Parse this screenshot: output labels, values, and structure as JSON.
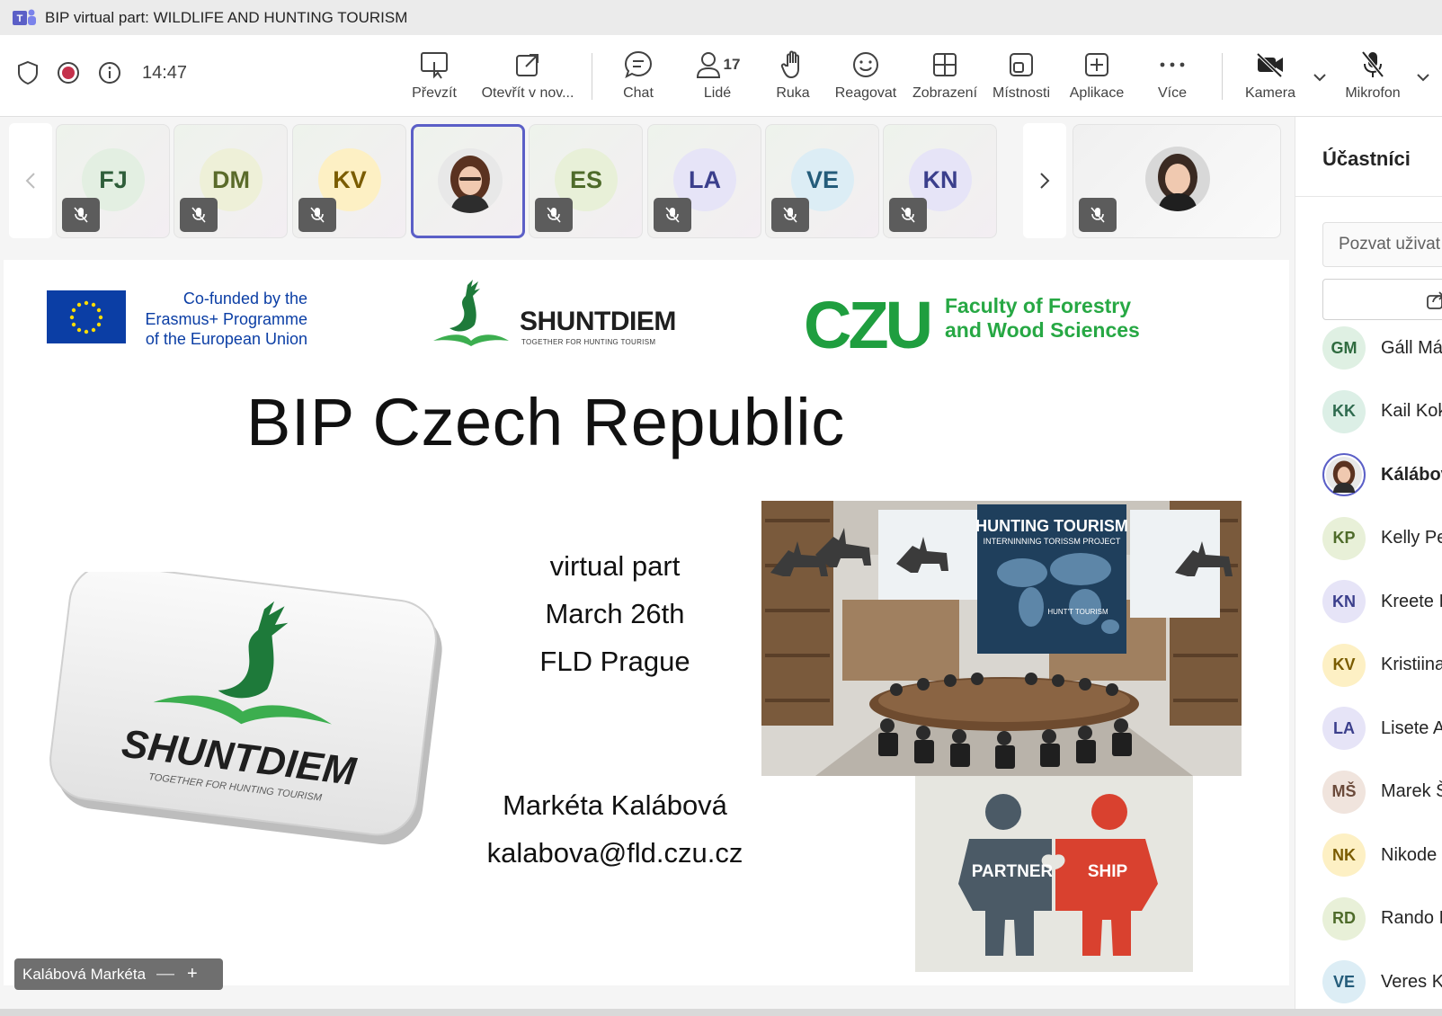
{
  "window": {
    "title": "BIP virtual part: WILDLIFE AND HUNTING TOURISM"
  },
  "toolbar": {
    "time": "14:47",
    "buttons": {
      "take_control": "Převzít",
      "open_new": "Otevřít v nov...",
      "chat": "Chat",
      "people": "Lidé",
      "people_count": "17",
      "hand": "Ruka",
      "react": "Reagovat",
      "view": "Zobrazení",
      "rooms": "Místnosti",
      "apps": "Aplikace",
      "more": "Více",
      "camera": "Kamera",
      "mic": "Mikrofon"
    }
  },
  "participants_strip": [
    {
      "initials": "FJ",
      "color": "#2f5e3a",
      "bg": "#e3efe2"
    },
    {
      "initials": "DM",
      "color": "#5a6b2a",
      "bg": "#eef0d8"
    },
    {
      "initials": "KV",
      "color": "#7a5c00",
      "bg": "#fdf0c4"
    },
    {
      "initials": "",
      "photo": true
    },
    {
      "initials": "ES",
      "color": "#4e6b2a",
      "bg": "#e8f0d8"
    },
    {
      "initials": "LA",
      "color": "#3b3f8c",
      "bg": "#e6e4f7"
    },
    {
      "initials": "VE",
      "color": "#245c7a",
      "bg": "#dcedf5"
    },
    {
      "initials": "KN",
      "color": "#3b3f8c",
      "bg": "#e6e4f7"
    }
  ],
  "slide": {
    "eu_text": [
      "Co-funded by the",
      "Erasmus+ Programme",
      "of the European Union"
    ],
    "shuntdiem_name": "SHUNTDIEM",
    "shuntdiem_tagline": "TOGETHER FOR HUNTING TOURISM",
    "czu_letters": "CZU",
    "faculty": [
      "Faculty of Forestry",
      "and Wood Sciences"
    ],
    "title": "BIP Czech Republic",
    "info": [
      "virtual part",
      "March 26th",
      "FLD Prague"
    ],
    "contact": [
      "Markéta Kalábová",
      "kalabova@fld.czu.cz"
    ],
    "poster_title": "HUNTING TOURISM",
    "poster_subtitle": "INTERNINNING TORISSM PROJECT",
    "poster_small": "HUNT'T TOURISM",
    "partner_left": "PARTNER",
    "partner_right": "SHIP"
  },
  "presenter_tag": {
    "name": "Kalábová Markéta",
    "minus": "—",
    "plus": "+"
  },
  "sidebar": {
    "title": "Účastníci",
    "invite_placeholder": "Pozvat uživat",
    "people": [
      {
        "initials": "GM",
        "name": "Gáll Má",
        "color": "#2f6b3f",
        "bg": "#dff0e3"
      },
      {
        "initials": "KK",
        "name": "Kail Kok",
        "color": "#2f6b4f",
        "bg": "#dcefe6"
      },
      {
        "initials": "",
        "name": "Kálábov",
        "photo": true,
        "me": true
      },
      {
        "initials": "KP",
        "name": "Kelly Pe",
        "color": "#4e6b2a",
        "bg": "#e8f0d8"
      },
      {
        "initials": "KN",
        "name": "Kreete I",
        "color": "#3b3f8c",
        "bg": "#e6e4f7"
      },
      {
        "initials": "KV",
        "name": "Kristiina",
        "color": "#7a5c00",
        "bg": "#fdf0c4"
      },
      {
        "initials": "LA",
        "name": "Lisete A",
        "color": "#3b3f8c",
        "bg": "#e6e4f7"
      },
      {
        "initials": "MŠ",
        "name": "Marek Š",
        "color": "#6b4a3a",
        "bg": "#f0e4dd"
      },
      {
        "initials": "NK",
        "name": "Nikode",
        "color": "#7a5c00",
        "bg": "#fdf0c4"
      },
      {
        "initials": "RD",
        "name": "Rando I",
        "color": "#4e6b2a",
        "bg": "#e8f0d8"
      },
      {
        "initials": "VE",
        "name": "Veres K",
        "color": "#245c7a",
        "bg": "#dcedf5"
      }
    ]
  }
}
